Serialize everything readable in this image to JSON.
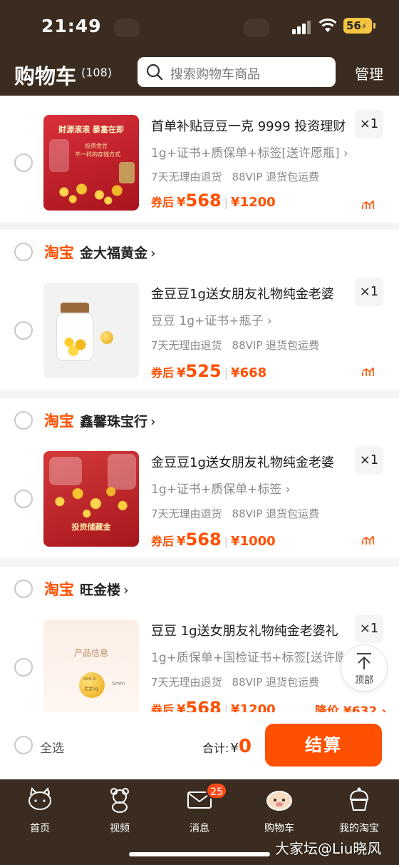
{
  "status_bar": {
    "time": "21:49",
    "battery": "56"
  },
  "header": {
    "title": "购物车",
    "count": "(108)",
    "search_placeholder": "搜索购物车商品",
    "manage_label": "管理"
  },
  "platform_label": "淘宝",
  "items": [
    {
      "shop": "",
      "title": "首单补贴豆豆一克 9999 投资理财",
      "qty": "×1",
      "sku": "1g+证书+质保单+标签[送许愿瓶] ›",
      "service1": "7天无理由退货",
      "service2": "88VIP 退货包运费",
      "price_label": "券后",
      "yen": "¥",
      "price": "568",
      "orig_price": "¥1200",
      "thumb_text1": "财源滚滚 暴富在即",
      "thumb_text2": "投资金豆",
      "thumb_text3": "不一样的存钱方式"
    },
    {
      "shop": "金大福黄金",
      "title": "金豆豆1g送女朋友礼物纯金老婆",
      "qty": "×1",
      "sku": "豆豆 1g+证书+瓶子 ›",
      "service1": "7天无理由退货",
      "service2": "88VIP 退货包运费",
      "price_label": "券后",
      "yen": "¥",
      "price": "525",
      "orig_price": "¥668"
    },
    {
      "shop": "鑫馨珠宝行",
      "title": "金豆豆1g送女朋友礼物纯金老婆",
      "qty": "×1",
      "sku": "1g+证书+质保单+标签 ›",
      "service1": "7天无理由退货",
      "service2": "88VIP 退货包运费",
      "price_label": "券后",
      "yen": "¥",
      "price": "568",
      "orig_price": "¥1000",
      "thumb_text1": "投资储藏金"
    },
    {
      "shop": "旺金楼",
      "title": "豆豆 1g送女朋友礼物纯金老婆礼",
      "qty": "×1",
      "sku": "1g+质保单+国检证书+标签[送许愿",
      "service1": "7天无理由退货",
      "service2": "88VIP 退货包运费",
      "price_label": "券后",
      "yen": "¥",
      "price": "568",
      "orig_price": "¥1200",
      "price_drop": "降价 ¥632 ›",
      "thumb_text1": "产品信息",
      "thumb_text2": "999.9",
      "thumb_text3": "足金1g",
      "thumb_text4": "5mm"
    }
  ],
  "back_to_top": "顶部",
  "checkout": {
    "select_all": "全选",
    "total_label": "合计:",
    "yen": "¥",
    "total": "0",
    "button": "结算"
  },
  "tabs": [
    {
      "label": "首页"
    },
    {
      "label": "视频"
    },
    {
      "label": "消息",
      "badge": "25"
    },
    {
      "label": "购物车"
    },
    {
      "label": "我的淘宝"
    }
  ],
  "watermark": "大家坛@Liu晓风",
  "colors": {
    "accent": "#ff5000",
    "header_bg": "#3a2c20"
  }
}
